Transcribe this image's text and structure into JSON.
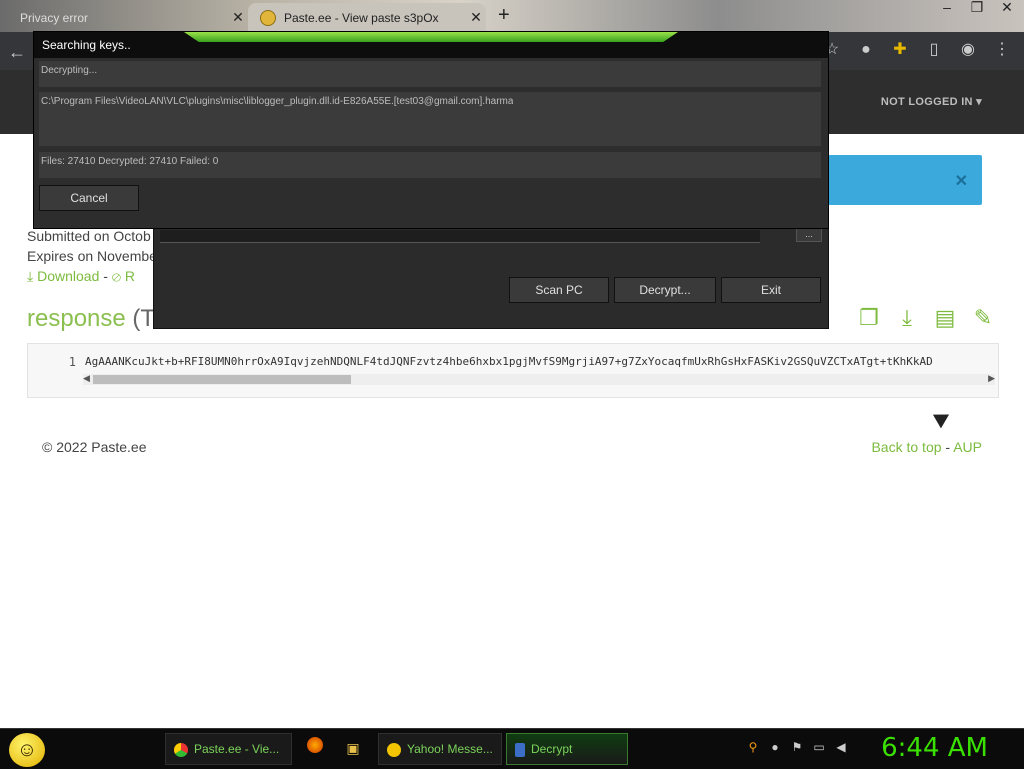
{
  "browser": {
    "tabs": [
      {
        "title": "Privacy error"
      },
      {
        "title": "Paste.ee - View paste s3pOx"
      }
    ],
    "new_tab": "+",
    "not_logged_in": "NOT LOGGED IN"
  },
  "paste": {
    "submitted": "Submitted on Octob",
    "expires": "Expires on Novembe",
    "download": "Download",
    "report_prefix": "R",
    "heading": "response",
    "heading_type": "(Te",
    "line_number": "1",
    "code": "AgAAANKcuJkt+b+RFI8UMN0hrrOxA9IqvjzehNDQNLF4tdJQNFzvtz4hbe6hxbx1pgjMvfS9MgrjiA97+g7ZxYocaqfmUxRhGsHxFASKiv2GSQuVZCTxATgt+tKhKkAD",
    "footer_copyright": "© 2022 Paste.ee",
    "back_to_top": "Back to top",
    "sep": "-",
    "aup": "AUP"
  },
  "dialog_main": {
    "title": "Searching keys..",
    "status": "Decrypting...",
    "path": "C:\\Program Files\\VideoLAN\\VLC\\plugins\\misc\\liblogger_plugin.dll.id-E826A55E.[test03@gmail.com].harma",
    "counts": "Files: 27410 Decrypted: 27410 Failed: 0",
    "cancel": "Cancel"
  },
  "dialog_back": {
    "browse": "...",
    "scan": "Scan PC",
    "decrypt": "Decrypt...",
    "exit": "Exit"
  },
  "taskbar": {
    "items": [
      {
        "label": "Paste.ee - Vie..."
      },
      {
        "label": "Yahoo! Messe..."
      },
      {
        "label": "Decrypt"
      }
    ],
    "clock": "6:44 AM"
  }
}
